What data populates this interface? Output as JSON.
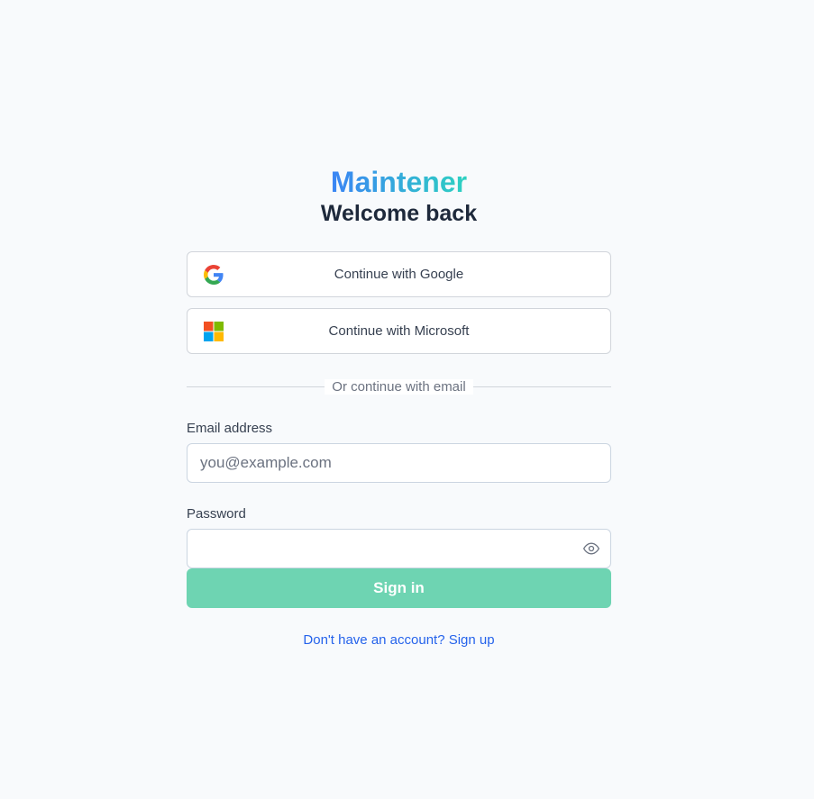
{
  "brand": {
    "name": "Maintener",
    "gradient_start": "#3b82f6",
    "gradient_end": "#2dd4bf"
  },
  "title": "Welcome back",
  "oauth": {
    "google_label": "Continue with Google",
    "google_icon": "google-logo-icon",
    "microsoft_label": "Continue with Microsoft",
    "microsoft_icon": "microsoft-logo-icon"
  },
  "divider_text": "Or continue with email",
  "email": {
    "label": "Email address",
    "placeholder": "you@example.com",
    "value": ""
  },
  "password": {
    "label": "Password",
    "value": "",
    "toggle_icon": "eye-icon"
  },
  "signin": {
    "label": "Sign in",
    "color": "#6ed4b2"
  },
  "signup_link": "Don't have an account? Sign up",
  "colors": {
    "background": "#f8fafc",
    "link": "#2563eb",
    "border": "#d1d5db"
  }
}
